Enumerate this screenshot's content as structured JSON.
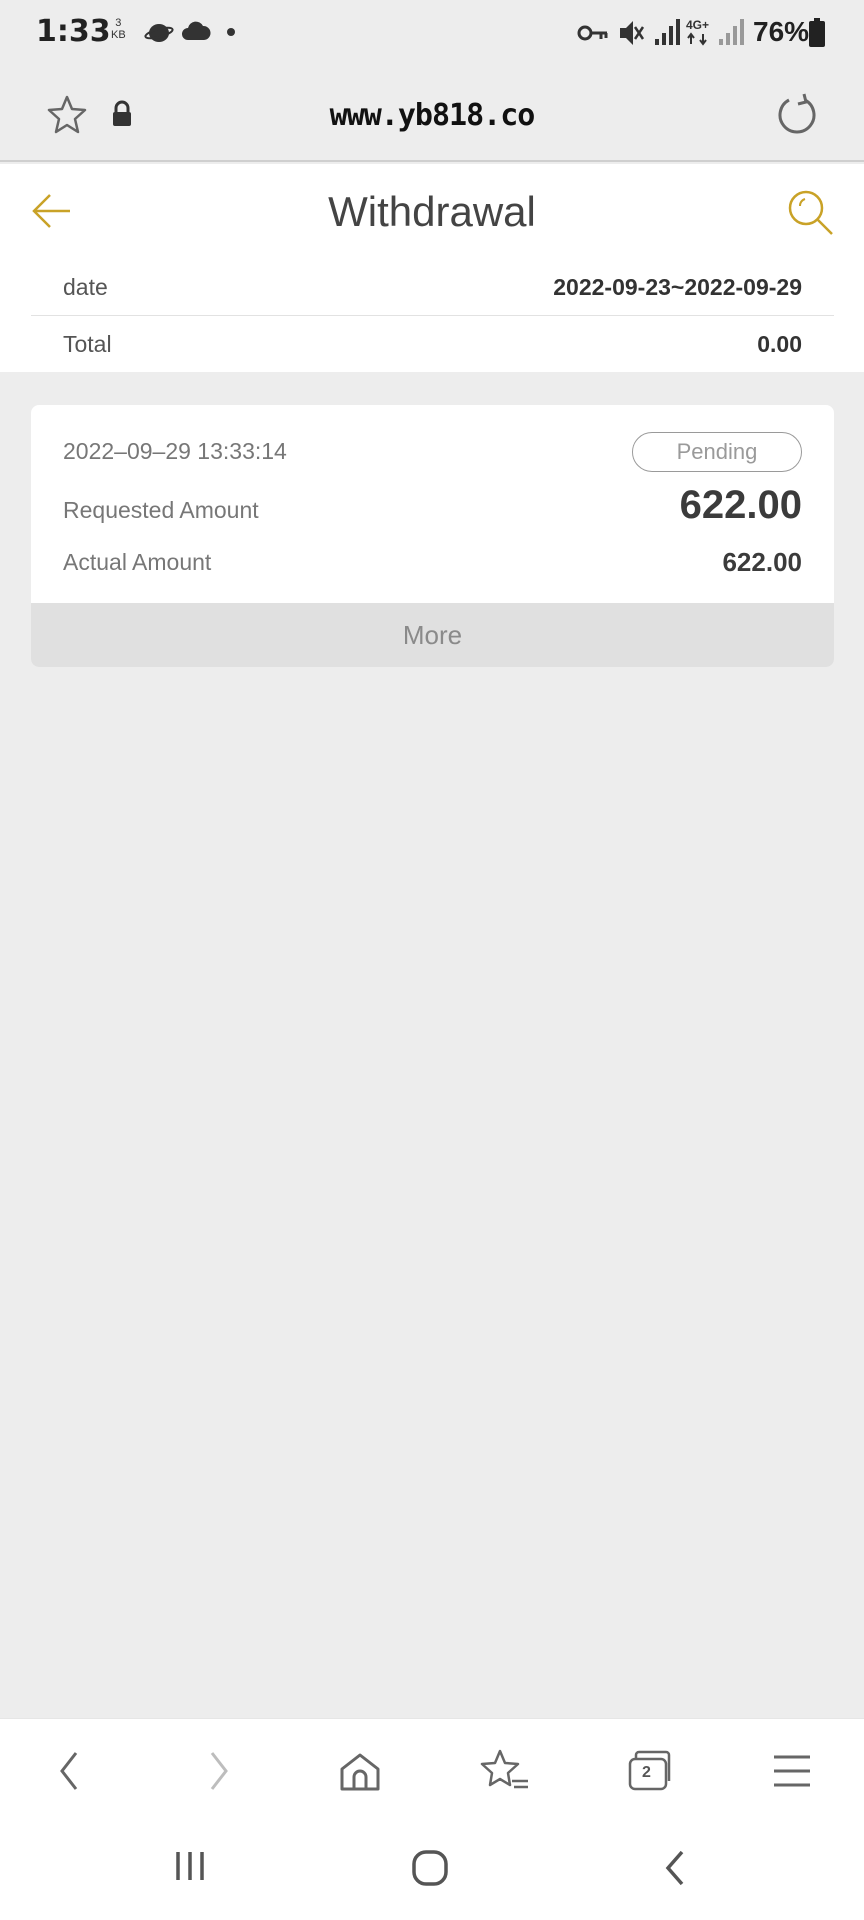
{
  "status_bar": {
    "time": "1:33",
    "data_speed_value": "3",
    "data_speed_unit": "KB",
    "network_label": "4G+",
    "battery": "76%",
    "icons": [
      "browser-planet-icon",
      "cloud-icon",
      "dot-icon",
      "vpn-key-icon",
      "mute-icon",
      "signal-icon",
      "battery-icon"
    ]
  },
  "url_bar": {
    "url": "www.yb818.co",
    "icons": [
      "star-icon",
      "lock-icon",
      "refresh-icon"
    ]
  },
  "header": {
    "title": "Withdrawal",
    "accent_color": "#c9a227"
  },
  "summary": {
    "date_label": "date",
    "date_value": "2022-09-23~2022-09-29",
    "total_label": "Total",
    "total_value": "0.00"
  },
  "record": {
    "timestamp": "2022–09–29 13:33:14",
    "status": "Pending",
    "requested_label": "Requested Amount",
    "requested_value": "622.00",
    "actual_label": "Actual Amount",
    "actual_value": "622.00",
    "more_label": "More"
  },
  "browser_nav": {
    "tabs_count": "2",
    "icons": [
      "back-icon",
      "forward-icon",
      "home-icon",
      "bookmarks-icon",
      "tabs-icon",
      "menu-icon"
    ]
  },
  "system_nav": {
    "icons": [
      "recent-apps-icon",
      "home-button-icon",
      "system-back-icon"
    ]
  }
}
